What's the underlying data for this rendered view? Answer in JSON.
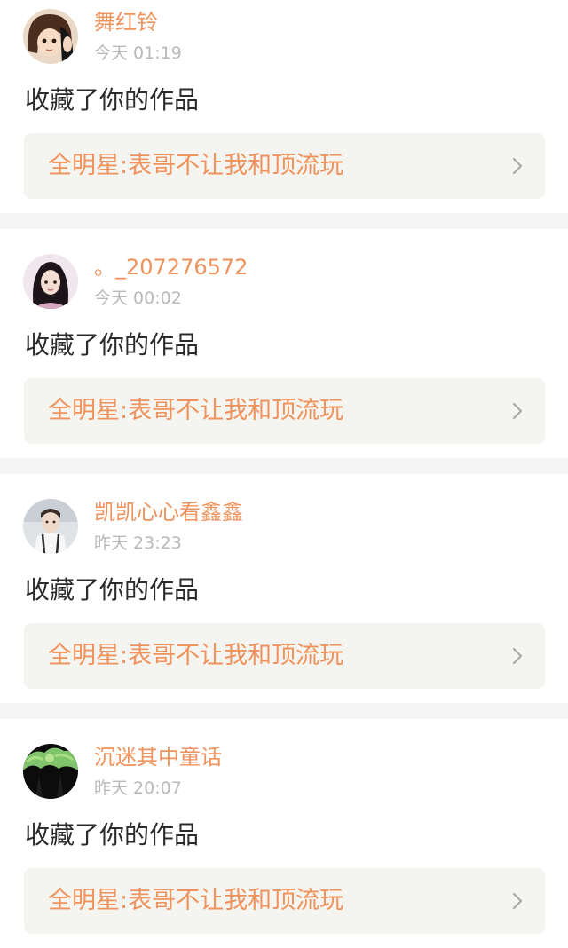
{
  "feed": {
    "items": [
      {
        "username": "舞红铃",
        "time": "今天 01:19",
        "action": "收藏了你的作品",
        "work_title": "全明星:表哥不让我和顶流玩",
        "avatar_icon": "anime-avatar-icon"
      },
      {
        "username": "。_207276572",
        "time": "今天 00:02",
        "action": "收藏了你的作品",
        "work_title": "全明星:表哥不让我和顶流玩",
        "avatar_icon": "girl-photo-avatar-icon"
      },
      {
        "username": "凯凯心心看鑫鑫",
        "time": "昨天 23:23",
        "action": "收藏了你的作品",
        "work_title": "全明星:表哥不让我和顶流玩",
        "avatar_icon": "boy-photo-avatar-icon"
      },
      {
        "username": "沉迷其中童话",
        "time": "昨天 20:07",
        "action": "收藏了你的作品",
        "work_title": "全明星:表哥不让我和顶流玩",
        "avatar_icon": "tree-avatar-icon"
      }
    ]
  },
  "colors": {
    "accent": "#f0925c",
    "timestamp": "#b9b9b9",
    "body_text": "#2b2b2b",
    "link_background": "#f4f4f0",
    "divider": "#f5f5f5"
  }
}
